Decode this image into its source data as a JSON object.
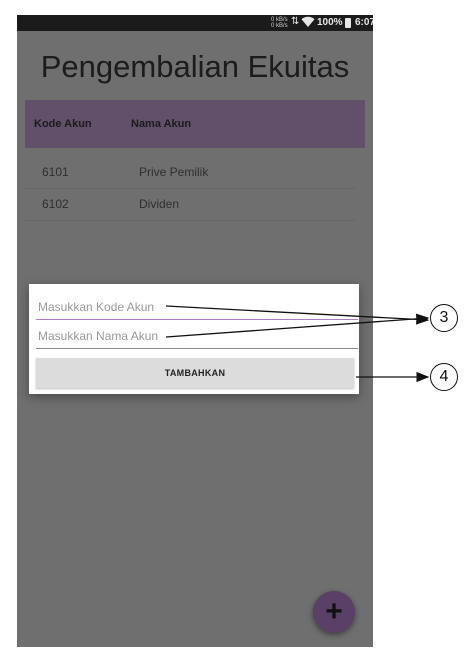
{
  "status_bar": {
    "net_up": "0 kB/s",
    "net_down": "0 kB/s",
    "battery": "100%",
    "time": "6:07"
  },
  "page": {
    "title": "Pengembalian Ekuitas"
  },
  "table": {
    "headers": [
      "Kode Akun",
      "Nama Akun"
    ],
    "rows": [
      {
        "code": "6101",
        "name": "Prive Pemilik"
      },
      {
        "code": "6102",
        "name": "Dividen"
      }
    ]
  },
  "dialog": {
    "kode_placeholder": "Masukkan Kode Akun",
    "nama_placeholder": "Masukkan Nama Akun",
    "add_button": "TAMBAHKAN"
  },
  "fab": {
    "icon": "plus-icon",
    "label": "+"
  },
  "callouts": [
    "3",
    "4"
  ]
}
